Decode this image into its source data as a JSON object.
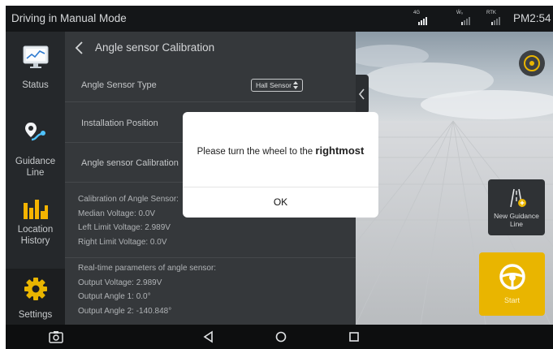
{
  "status_bar": {
    "title": "Driving in Manual Mode",
    "signals": [
      {
        "label": "4G",
        "icon": "cellular-signal-icon"
      },
      {
        "label": "Ẅ₀",
        "icon": "radio-signal-icon"
      },
      {
        "label": "RTK",
        "icon": "rtk-signal-icon"
      }
    ],
    "time": "PM2:54"
  },
  "nav": {
    "items": [
      {
        "label": "Status",
        "icon": "monitor-chart-icon"
      },
      {
        "label": "Guidance Line",
        "icon": "route-pin-icon"
      },
      {
        "label": "Location History",
        "icon": "bar-chart-icon"
      },
      {
        "label": "Settings",
        "icon": "gear-icon",
        "selected": true
      }
    ]
  },
  "panel": {
    "title": "Angle sensor Calibration",
    "rows": [
      {
        "label": "Angle Sensor Type",
        "value": "Hall Sensor"
      },
      {
        "label": "Installation Position",
        "value": ""
      },
      {
        "label": "Angle sensor Calibration",
        "value": ""
      }
    ],
    "calibration": {
      "heading": "Calibration of Angle Sensor:",
      "lines": [
        "Median Voltage: 0.0V",
        "Left Limit Voltage: 2.989V",
        "Right Limit Voltage: 0.0V"
      ]
    },
    "realtime": {
      "heading": "Real-time parameters of angle sensor:",
      "lines": [
        "Output Voltage: 2.989V",
        "Output Angle 1: 0.0°",
        "Output Angle 2: -140.848°"
      ]
    }
  },
  "view": {
    "new_guidance_line": "New Guidance Line",
    "start": "Start"
  },
  "dialog": {
    "message_prefix": "Please turn the wheel to the ",
    "message_emphasis": "rightmost",
    "ok": "OK"
  },
  "colors": {
    "accent": "#e9b500",
    "status_bar": "#141618",
    "nav_bg": "#25282b",
    "panel_bg": "#35383b"
  }
}
